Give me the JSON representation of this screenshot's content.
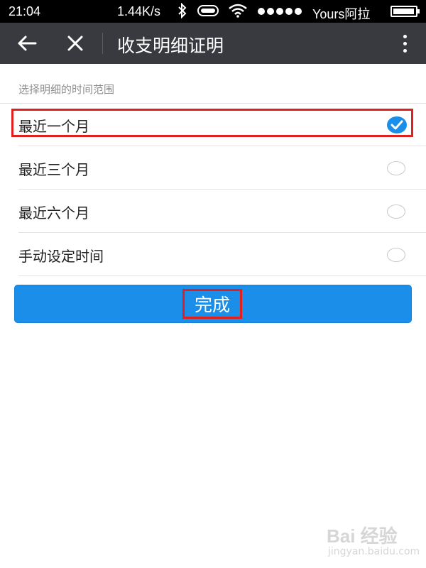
{
  "status_bar": {
    "time": "21:04",
    "speed": "1.44K/s",
    "carrier": "Yours阿拉",
    "battery_level": 0.95
  },
  "header": {
    "title": "收支明细证明"
  },
  "section": {
    "label": "选择明细的时间范围"
  },
  "options": [
    {
      "label": "最近一个月",
      "selected": true
    },
    {
      "label": "最近三个月",
      "selected": false
    },
    {
      "label": "最近六个月",
      "selected": false
    },
    {
      "label": "手动设定时间",
      "selected": false
    }
  ],
  "done_button": {
    "label": "完成"
  },
  "watermark": {
    "text": "Bai 经验",
    "sub": "jingyan.baidu.com"
  },
  "colors": {
    "accent": "#1a8ee8",
    "header_bg": "#393a3f",
    "highlight": "#e0201c"
  }
}
